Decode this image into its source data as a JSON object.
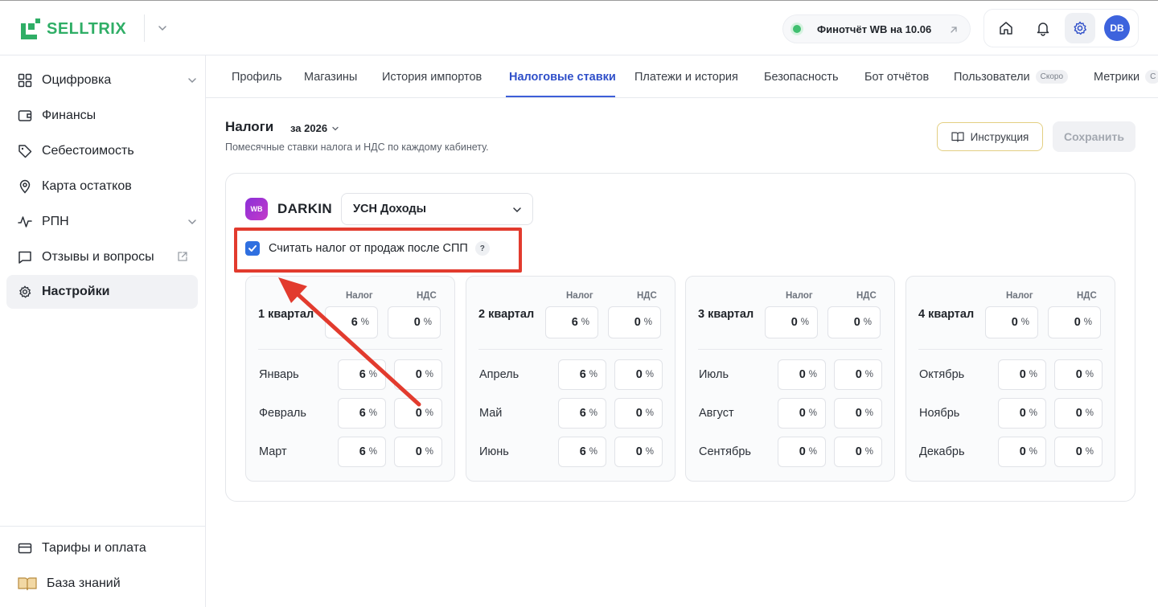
{
  "app": {
    "logo_text": "SELLTRIX"
  },
  "header": {
    "report_label": "Финотчёт WB на 10.06",
    "avatar_initials": "DB"
  },
  "sidebar": {
    "items": [
      {
        "label": "Оцифровка",
        "icon": "grid-icon"
      },
      {
        "label": "Финансы",
        "icon": "wallet-icon"
      },
      {
        "label": "Себестоимость",
        "icon": "tag-icon"
      },
      {
        "label": "Карта остатков",
        "icon": "map-pin-icon"
      },
      {
        "label": "РПН",
        "icon": "activity-icon"
      },
      {
        "label": "Отзывы и вопросы",
        "icon": "message-icon"
      },
      {
        "label": "Настройки",
        "icon": "gear-icon"
      }
    ],
    "bottom": [
      {
        "label": "Тарифы и оплата",
        "icon": "credit-card-icon"
      },
      {
        "label": "База знаний",
        "icon": "book-icon"
      }
    ]
  },
  "tabs": [
    {
      "label": "Профиль"
    },
    {
      "label": "Магазины"
    },
    {
      "label": "История импортов"
    },
    {
      "label": "Налоговые ставки"
    },
    {
      "label": "Платежи и история"
    },
    {
      "label": "Безопасность"
    },
    {
      "label": "Бот отчётов"
    },
    {
      "label": "Пользователи",
      "badge": "Скоро"
    },
    {
      "label": "Метрики",
      "badge": "С"
    }
  ],
  "page": {
    "title": "Налоги",
    "year": "за 2026",
    "subtitle": "Помесячные ставки налога и НДС по каждому кабинету.",
    "instruction_label": "Инструкция",
    "save_label": "Сохранить"
  },
  "shop": {
    "badge": "WB",
    "name": "DARKIN",
    "regime": "УСН Доходы",
    "spp_label": "Считать налог от продаж после СПП",
    "spp_checked": true,
    "help": "?"
  },
  "columns": {
    "tax": "Налог",
    "vat": "НДС",
    "percent": "%"
  },
  "quarters": [
    {
      "name": "1 квартал",
      "tax": "6",
      "vat": "0",
      "months": [
        {
          "name": "Январь",
          "tax": "6",
          "vat": "0"
        },
        {
          "name": "Февраль",
          "tax": "6",
          "vat": "0"
        },
        {
          "name": "Март",
          "tax": "6",
          "vat": "0"
        }
      ]
    },
    {
      "name": "2 квартал",
      "tax": "6",
      "vat": "0",
      "months": [
        {
          "name": "Апрель",
          "tax": "6",
          "vat": "0"
        },
        {
          "name": "Май",
          "tax": "6",
          "vat": "0"
        },
        {
          "name": "Июнь",
          "tax": "6",
          "vat": "0"
        }
      ]
    },
    {
      "name": "3 квартал",
      "tax": "0",
      "vat": "0",
      "months": [
        {
          "name": "Июль",
          "tax": "0",
          "vat": "0"
        },
        {
          "name": "Август",
          "tax": "0",
          "vat": "0"
        },
        {
          "name": "Сентябрь",
          "tax": "0",
          "vat": "0"
        }
      ]
    },
    {
      "name": "4 квартал",
      "tax": "0",
      "vat": "0",
      "months": [
        {
          "name": "Октябрь",
          "tax": "0",
          "vat": "0"
        },
        {
          "name": "Ноябрь",
          "tax": "0",
          "vat": "0"
        },
        {
          "name": "Декабрь",
          "tax": "0",
          "vat": "0"
        }
      ]
    }
  ],
  "colors": {
    "brand_green": "#2fae66",
    "accent_blue": "#3d5ed8",
    "annotation_red": "#e23b2e"
  }
}
